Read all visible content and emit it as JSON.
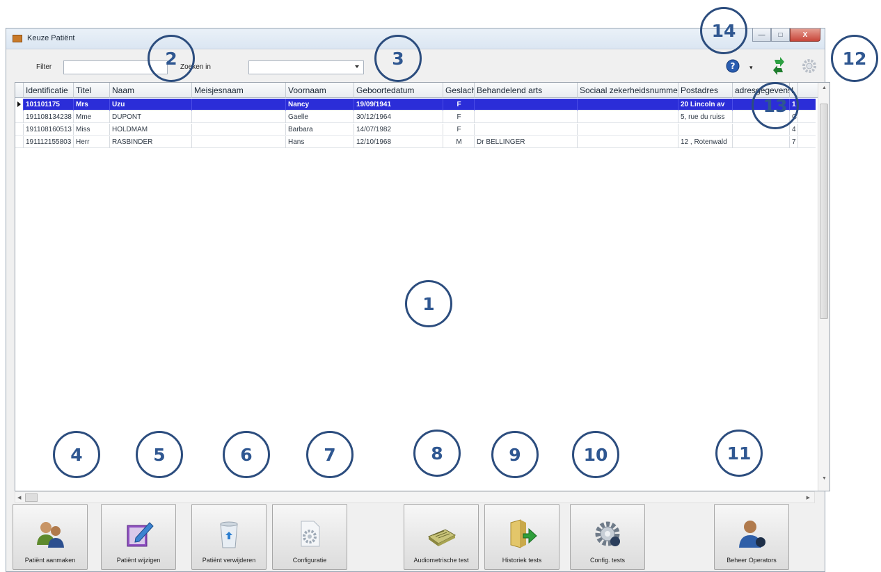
{
  "window": {
    "title": "Keuze Patiënt",
    "minimize": "—",
    "maximize": "□",
    "close": "X"
  },
  "toolbar": {
    "filter_label": "Filter",
    "filter_value": "",
    "search_in_label": "Zoeken in",
    "search_in_value": "",
    "help_dropdown": "▾",
    "icons": [
      "help-icon",
      "refresh-icon",
      "settings-icon"
    ]
  },
  "table": {
    "columns": [
      "Identificatie",
      "Titel",
      "Naam",
      "Meisjesnaam",
      "Voornaam",
      "Geboortedatum",
      "Geslacht",
      "Behandelend arts",
      "Sociaal zekerheidsnummer",
      "Postadres",
      "adresgegevens",
      "I"
    ],
    "rows": [
      [
        "101101175",
        "Mrs",
        "Uzu",
        "",
        "Nancy",
        "19/09/1941",
        "F",
        "",
        "",
        "20 Lincoln av",
        "",
        "1"
      ],
      [
        "191108134238",
        "Mme",
        "DUPONT",
        "",
        "Gaelle",
        "30/12/1964",
        "F",
        "",
        "",
        "5, rue du ruiss",
        "",
        "C"
      ],
      [
        "191108160513",
        "Miss",
        "HOLDMAM",
        "",
        "Barbara",
        "14/07/1982",
        "F",
        "",
        "",
        "",
        "",
        "4"
      ],
      [
        "191112155803",
        "Herr",
        "RASBINDER",
        "",
        "Hans",
        "12/10/1968",
        "M",
        "Dr BELLINGER",
        "",
        "12 , Rotenwald",
        "",
        "7"
      ]
    ]
  },
  "buttons": [
    {
      "label": "Patiënt aanmaken",
      "icon": "users-icon"
    },
    {
      "label": "Patiënt wijzigen",
      "icon": "edit-icon"
    },
    {
      "label": "Patiënt verwijderen",
      "icon": "recycle-bin-icon"
    },
    {
      "label": "Configuratie",
      "icon": "config-icon"
    },
    {
      "label": "Audiometrische test",
      "icon": "audiometer-icon"
    },
    {
      "label": "Historiek tests",
      "icon": "history-folder-icon"
    },
    {
      "label": "Config. tests",
      "icon": "gear-icon"
    },
    {
      "label": "Beheer Operators",
      "icon": "operator-icon"
    }
  ],
  "callouts": [
    "1",
    "2",
    "3",
    "4",
    "5",
    "6",
    "7",
    "8",
    "9",
    "10",
    "11",
    "12",
    "13",
    "14"
  ],
  "colors": {
    "callout": "#2f5791",
    "selected_row": "#2b2dd8",
    "close_button": "#c8463a"
  }
}
